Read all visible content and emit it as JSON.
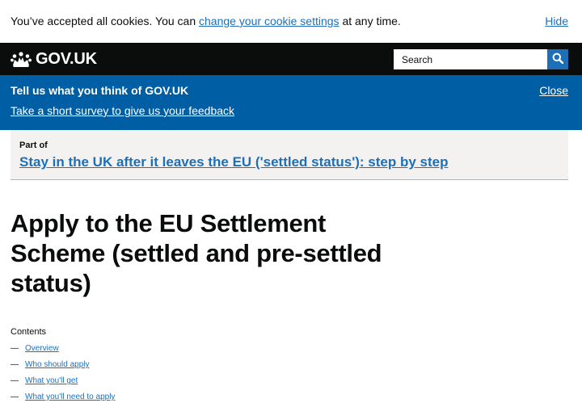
{
  "cookie_banner": {
    "message_before": "You’ve accepted all cookies. You can ",
    "settings_link": "change your cookie settings",
    "message_after": " at any time.",
    "hide_label": "Hide"
  },
  "header": {
    "logo_text": "GOV.UK",
    "logo_icon": "crown-icon",
    "search_placeholder": "Search",
    "search_icon": "search-icon"
  },
  "survey_banner": {
    "title": "Tell us what you think of GOV.UK",
    "link": "Take a short survey to give us your feedback",
    "close_label": "Close"
  },
  "part_of": {
    "label": "Part of",
    "link": "Stay in the UK after it leaves the EU ('settled status'): step by step"
  },
  "page": {
    "title": "Apply to the EU Settlement Scheme (settled and pre-settled status)"
  },
  "contents": {
    "heading": "Contents",
    "dash": "—",
    "items": [
      "Overview",
      "Who should apply",
      "What you'll get",
      "What you'll need to apply"
    ]
  },
  "colors": {
    "header_bg": "#0b0c0c",
    "survey_bg": "#005ea5",
    "link": "#1d70b8",
    "part_of_bg": "#f3f2f1"
  }
}
